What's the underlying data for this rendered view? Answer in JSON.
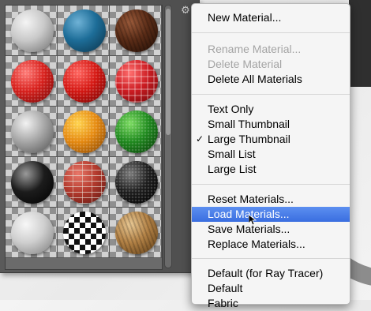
{
  "panel": {
    "gear_icon": "gear-icon",
    "materials": [
      {
        "name": "white-plaster",
        "colors": [
          "#f4f4f4",
          "#c9c9c9",
          "#6e6e6e"
        ],
        "pattern": "none"
      },
      {
        "name": "blue-glossy",
        "colors": [
          "#6fb2d6",
          "#1d6d98",
          "#0b3147"
        ],
        "pattern": "none"
      },
      {
        "name": "dark-wood",
        "colors": [
          "#9a5a3a",
          "#5a2c17",
          "#1f0d05"
        ],
        "pattern": "grain"
      },
      {
        "name": "red-fabric-dots",
        "colors": [
          "#ff7c78",
          "#d8201c",
          "#6f0808"
        ],
        "pattern": "dots"
      },
      {
        "name": "red-leather",
        "colors": [
          "#ff6660",
          "#d51712",
          "#6d0404"
        ],
        "pattern": "dots"
      },
      {
        "name": "red-plaid",
        "colors": [
          "#ff6f6f",
          "#cc1c22",
          "#6a0508"
        ],
        "pattern": "plaid"
      },
      {
        "name": "grey-matte",
        "colors": [
          "#f2f2f2",
          "#a8a8a8",
          "#4e4e4e"
        ],
        "pattern": "none"
      },
      {
        "name": "orange-textured",
        "colors": [
          "#ffd44f",
          "#e68a10",
          "#7d3e02"
        ],
        "pattern": "dots"
      },
      {
        "name": "green-textured",
        "colors": [
          "#7ddc63",
          "#1f8a1e",
          "#073607"
        ],
        "pattern": "dots"
      },
      {
        "name": "black-glossy",
        "colors": [
          "#9a9a9a",
          "#1c1c1c",
          "#000000"
        ],
        "pattern": "none"
      },
      {
        "name": "red-brick",
        "colors": [
          "#e9786a",
          "#b33a2d",
          "#5a1510"
        ],
        "pattern": "brick"
      },
      {
        "name": "black-granite",
        "colors": [
          "#7a7a7a",
          "#1d1d1d",
          "#000000"
        ],
        "pattern": "dots"
      },
      {
        "name": "white-stucco",
        "colors": [
          "#f7f7f7",
          "#cfcfcf",
          "#7a7a7a"
        ],
        "pattern": "none"
      },
      {
        "name": "checker",
        "colors": [
          "#ffffff",
          "#111111",
          "#000000"
        ],
        "pattern": "checker"
      },
      {
        "name": "tan-rock",
        "colors": [
          "#e8c894",
          "#b38246",
          "#5c3b14"
        ],
        "pattern": "grain"
      }
    ]
  },
  "menu": {
    "items": [
      {
        "label": "New Material...",
        "state": "enabled"
      },
      {
        "label": "Rename Material...",
        "state": "disabled"
      },
      {
        "label": "Delete Material",
        "state": "disabled"
      },
      {
        "label": "Delete All Materials",
        "state": "enabled"
      },
      {
        "label": "Text Only",
        "state": "enabled"
      },
      {
        "label": "Small Thumbnail",
        "state": "enabled"
      },
      {
        "label": "Large Thumbnail",
        "state": "checked"
      },
      {
        "label": "Small List",
        "state": "enabled"
      },
      {
        "label": "Large List",
        "state": "enabled"
      },
      {
        "label": "Reset Materials...",
        "state": "enabled"
      },
      {
        "label": "Load Materials...",
        "state": "highlighted"
      },
      {
        "label": "Save Materials...",
        "state": "enabled"
      },
      {
        "label": "Replace Materials...",
        "state": "enabled"
      },
      {
        "label": "Default (for Ray Tracer)",
        "state": "enabled"
      },
      {
        "label": "Default",
        "state": "enabled"
      },
      {
        "label": "Fabric",
        "state": "enabled"
      }
    ],
    "check_mark": "✓",
    "highlight_color": "#3a6ee0"
  }
}
